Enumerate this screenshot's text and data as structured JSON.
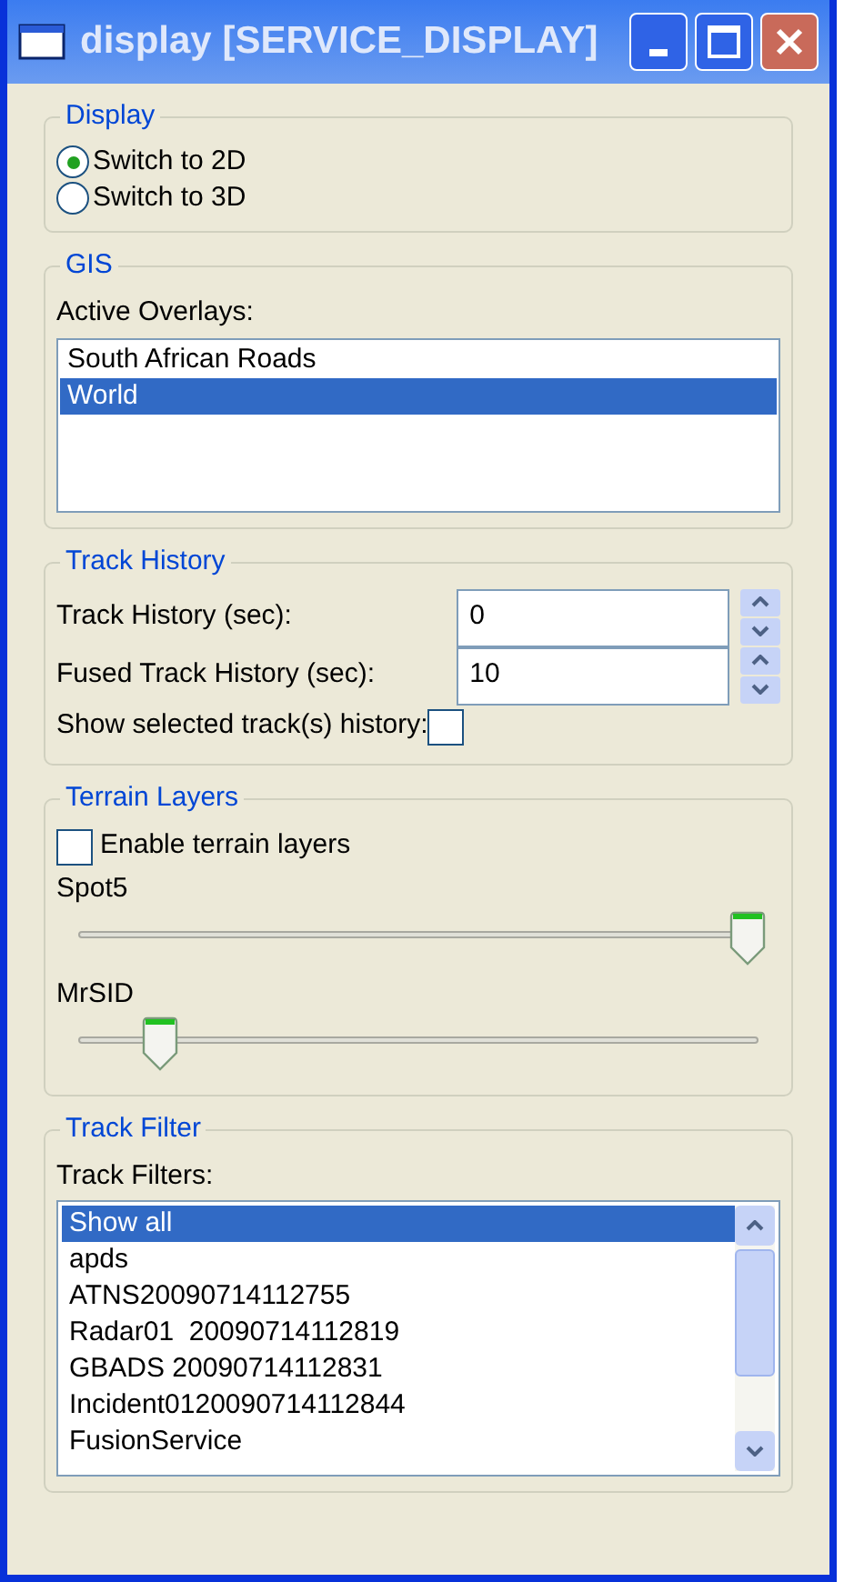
{
  "window": {
    "title": "display [SERVICE_DISPLAY]"
  },
  "display": {
    "title": "Display",
    "options": [
      {
        "label": "Switch to 2D",
        "selected": true
      },
      {
        "label": "Switch to 3D",
        "selected": false
      }
    ]
  },
  "gis": {
    "title": "GIS",
    "label": "Active Overlays:",
    "overlays": [
      {
        "label": "South African Roads",
        "selected": false
      },
      {
        "label": "World",
        "selected": true
      }
    ]
  },
  "track_history": {
    "title": "Track History",
    "fields": [
      {
        "label": "Track History (sec):",
        "value": "0"
      },
      {
        "label": "Fused Track History (sec):",
        "value": "10"
      }
    ],
    "show_selected": {
      "label": "Show selected track(s) history:",
      "checked": false
    }
  },
  "terrain": {
    "title": "Terrain Layers",
    "enable": {
      "label": "Enable terrain layers",
      "checked": false
    },
    "layers": [
      {
        "name": "Spot5",
        "level": 0.985
      },
      {
        "name": "MrSID",
        "level": 0.12
      }
    ]
  },
  "track_filter": {
    "title": "Track Filter",
    "label": "Track Filters:",
    "filters": [
      {
        "label": "Show all",
        "selected": true
      },
      {
        "label": "apds",
        "selected": false
      },
      {
        "label": "ATNS20090714112755",
        "selected": false
      },
      {
        "label": "Radar01  20090714112819",
        "selected": false
      },
      {
        "label": "GBADS 20090714112831",
        "selected": false
      },
      {
        "label": "Incident0120090714112844",
        "selected": false
      },
      {
        "label": "FusionService",
        "selected": false
      }
    ]
  }
}
